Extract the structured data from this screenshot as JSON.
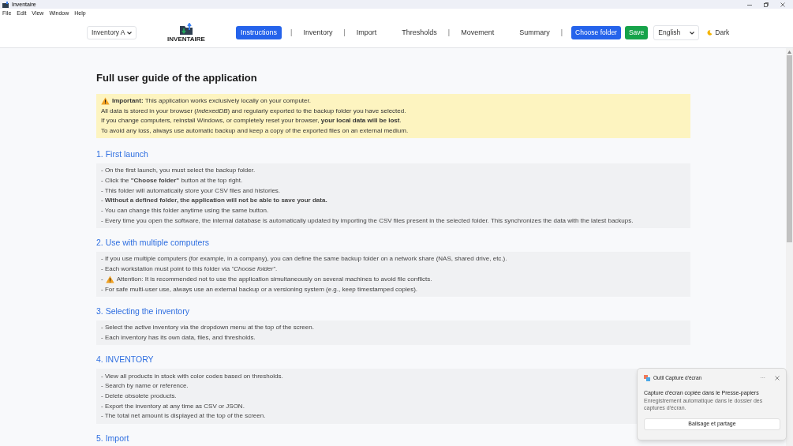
{
  "window": {
    "title": "Inventaire"
  },
  "menu_bar": [
    "File",
    "Edit",
    "View",
    "Window",
    "Help"
  ],
  "header": {
    "inventory_select": "Inventory A",
    "logo_text": "INVENTAIRE",
    "nav": [
      {
        "label": "Instructions",
        "selected": true,
        "separator_after": "|"
      },
      {
        "label": "Inventory",
        "selected": false,
        "separator_after": "|"
      },
      {
        "label": "Import",
        "selected": false
      },
      {
        "label": "Thresholds",
        "selected": false,
        "separator_after": "|"
      },
      {
        "label": "Movement",
        "selected": false
      },
      {
        "label": "Summary",
        "selected": false,
        "separator_after": "|"
      }
    ],
    "buttons": [
      {
        "label": "Choose folder",
        "kind": "primary"
      },
      {
        "label": "Save",
        "kind": "success"
      }
    ],
    "language_select": "English",
    "theme_toggle": "Dark"
  },
  "guide": {
    "title": "Full user guide of the application",
    "notice": [
      "**Important:** This application works exclusively locally on your computer.",
      "All data is stored in your browser (*IndexedDB*) and regularly exported to the backup folder you have selected.",
      "If you change computers, reinstall Windows, or completely reset your browser, **your local data will be lost**.",
      "To avoid any loss, always use automatic backup and keep a copy of the exported files on an external medium."
    ],
    "sections": [
      {
        "heading": "1. First launch",
        "lines": [
          {
            "text": "- On the first launch, you must select the backup folder."
          },
          {
            "text": "- Click the **\"Choose folder\"** button at the top right."
          },
          {
            "text": "- This folder will automatically store your CSV files and histories."
          },
          {
            "text": "- **Without a defined folder, the application will not be able to save your data.**"
          },
          {
            "text": "- You can change this folder anytime using the same button."
          },
          {
            "text": "- Every time you open the software, the internal database is automatically updated by importing the CSV files present in the selected folder. This synchronizes the data with the latest backups."
          }
        ]
      },
      {
        "heading": "2. Use with multiple computers",
        "lines": [
          {
            "text": "- If you use multiple computers (for example, in a company), you can define the same backup folder on a network share (NAS, shared drive, etc.)."
          },
          {
            "text": "- Each workstation must point to this folder via *\"Choose folder\"*."
          },
          {
            "dash": "-",
            "kind": "warning",
            "text": "Attention: It is recommended not to use the application simultaneously on several machines to avoid file conflicts."
          },
          {
            "text": "- For safe multi-user use, always use an external backup or a versioning system (e.g., keep timestamped copies)."
          }
        ]
      },
      {
        "heading": "3. Selecting the inventory",
        "lines": [
          {
            "text": "- Select the active inventory via the dropdown menu at the top of the screen."
          },
          {
            "text": "- Each inventory has its own data, files, and thresholds."
          }
        ]
      },
      {
        "heading": "4. INVENTORY",
        "lines": [
          {
            "text": "- View all products in stock with color codes based on thresholds."
          },
          {
            "text": "- Search by name or reference."
          },
          {
            "text": "- Delete obsolete products."
          },
          {
            "text": "- Export the inventory at any time as CSV or JSON."
          },
          {
            "text": "- The total net amount is displayed at the top of the screen."
          }
        ]
      },
      {
        "heading": "5. Import"
      }
    ]
  },
  "toast": {
    "app": "Outil Capture d'écran",
    "more": "···",
    "title": "Capture d'écran copiée dans le Presse-papiers",
    "body": "Enregistrement automatique dans le dossier des captures d'écran.",
    "button": "Balisage et partage"
  }
}
